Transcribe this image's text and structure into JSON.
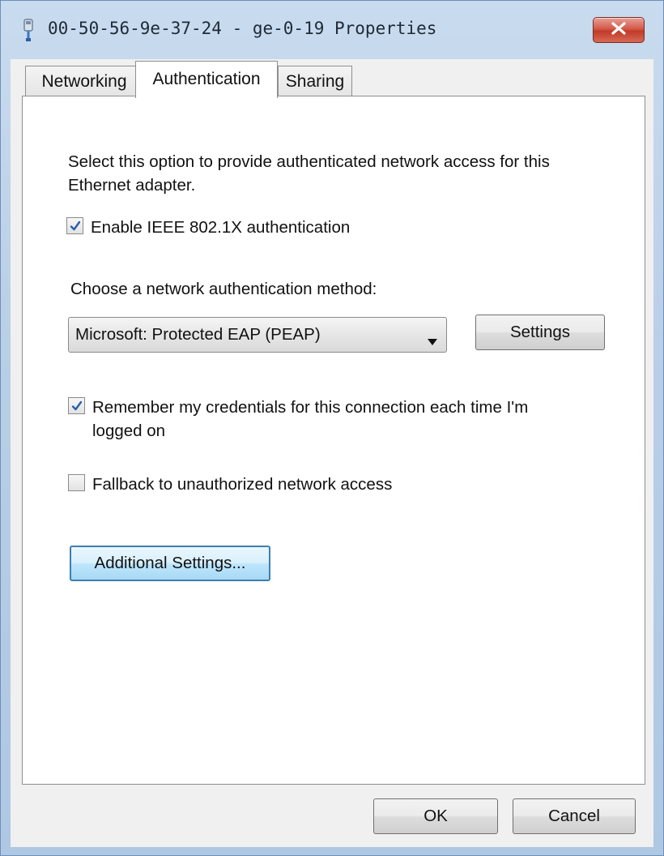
{
  "window": {
    "title": "00-50-56-9e-37-24 - ge-0-19 Properties",
    "icons": {
      "app": "network-adapter-icon",
      "close": "close-icon"
    }
  },
  "tabs": [
    {
      "label": "Networking",
      "selected": false
    },
    {
      "label": "Authentication",
      "selected": true
    },
    {
      "label": "Sharing",
      "selected": false
    }
  ],
  "authentication": {
    "description": "Select this option to provide authenticated network access for this Ethernet adapter.",
    "enable_8021x": {
      "label": "Enable IEEE 802.1X authentication",
      "checked": true
    },
    "method_label": "Choose a network authentication method:",
    "method_selected": "Microsoft: Protected EAP (PEAP)",
    "settings_button": "Settings",
    "remember_credentials": {
      "label": "Remember my credentials for this connection each time I'm logged on",
      "checked": true
    },
    "fallback": {
      "label": "Fallback to unauthorized network access",
      "checked": false
    },
    "additional_settings_button": "Additional Settings..."
  },
  "footer": {
    "ok_label": "OK",
    "cancel_label": "Cancel"
  },
  "colors": {
    "accent_focus": "#3c7fb1",
    "close_button": "#c23a28",
    "checkmark": "#2a5fa8"
  }
}
